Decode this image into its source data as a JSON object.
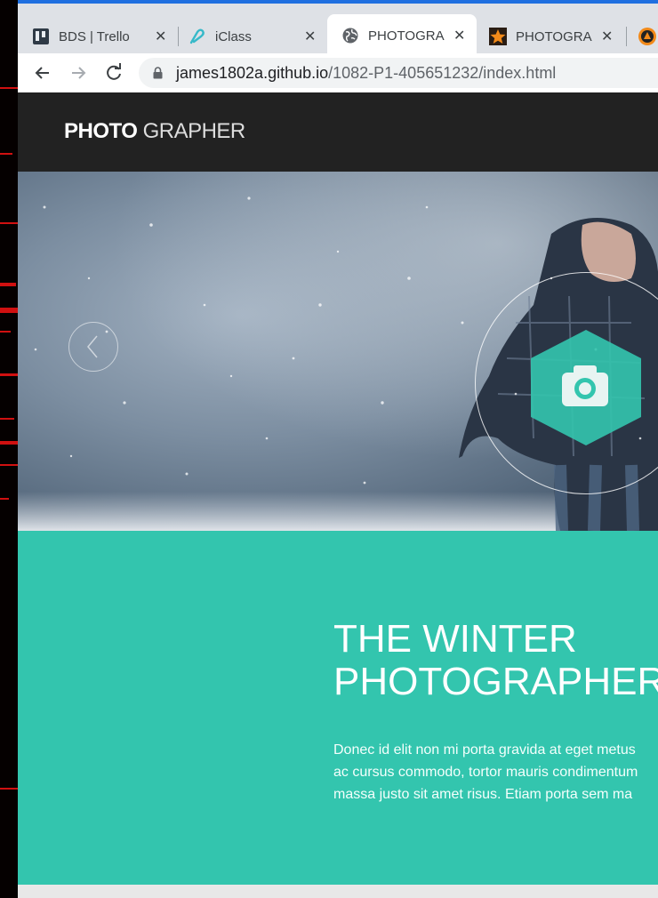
{
  "browser": {
    "tabs": [
      {
        "title": "BDS | Trello",
        "favicon": "trello-icon",
        "active": false
      },
      {
        "title": "iClass",
        "favicon": "iclass-icon",
        "active": false
      },
      {
        "title": "PHOTOGRA",
        "favicon": "globe-icon",
        "active": true
      },
      {
        "title": "PHOTOGRA",
        "favicon": "star-icon",
        "active": false
      }
    ],
    "url": {
      "host": "james1802a.github.io",
      "path": "/1082-P1-405651232/index.html"
    }
  },
  "site": {
    "logo_bold": "PHOTO",
    "logo_light": "GRAPHER",
    "hero": {
      "prev_icon": "chevron-left-icon",
      "badge_icon": "camera-icon"
    },
    "title_line1": "THE WINTER",
    "title_line2": "PHOTOGRAPHER",
    "body_lines": [
      "Donec id elit non mi porta gravida at eget metus",
      "ac cursus commodo, tortor mauris condimentum",
      "massa justo sit amet risus. Etiam porta sem ma"
    ]
  },
  "colors": {
    "accent": "#33c5ae",
    "header_bg": "#222222",
    "tab_active_indicator": "#1f6fe0"
  }
}
